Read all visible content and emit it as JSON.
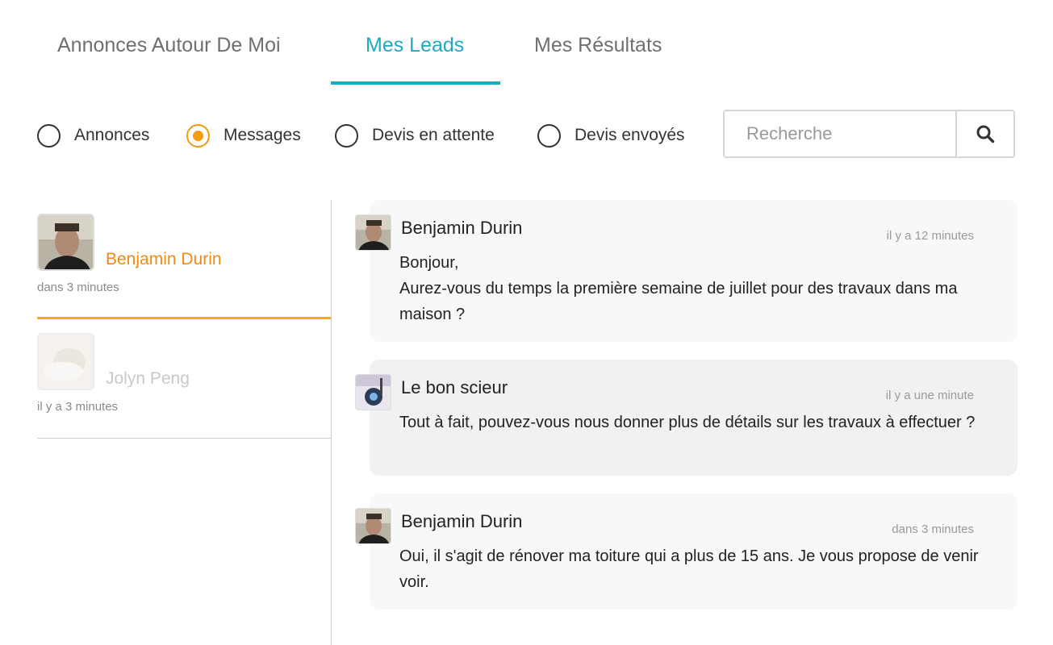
{
  "tabs": [
    {
      "label": "Annonces Autour De Moi",
      "active": false
    },
    {
      "label": "Mes Leads",
      "active": true
    },
    {
      "label": "Mes Résultats",
      "active": false
    }
  ],
  "filters": [
    {
      "label": "Annonces",
      "checked": false
    },
    {
      "label": "Messages",
      "checked": true
    },
    {
      "label": "Devis en attente",
      "checked": false
    },
    {
      "label": "Devis envoyés",
      "checked": false
    }
  ],
  "search": {
    "placeholder": "Recherche",
    "value": "",
    "icon": "search-icon"
  },
  "leads": [
    {
      "name": "Benjamin Durin",
      "time": "dans 3 minutes",
      "active": true
    },
    {
      "name": "Jolyn Peng",
      "time": "il y a 3 minutes",
      "active": false
    }
  ],
  "messages": [
    {
      "author": "Benjamin Durin",
      "time": "il y a 12 minutes",
      "lines": [
        "Bonjour,",
        "Aurez-vous du temps la première semaine de juillet pour des travaux dans ma maison ?"
      ]
    },
    {
      "author": "Le bon scieur",
      "time": "il y a une minute",
      "lines": [
        "Tout à fait, pouvez-vous nous donner plus de détails sur les travaux à effectuer ?"
      ]
    },
    {
      "author": "Benjamin Durin",
      "time": "dans 3 minutes",
      "lines": [
        "Oui, il s'agit de rénover ma toiture qui a plus de 15 ans. Je vous propose de venir voir."
      ]
    }
  ],
  "colors": {
    "accent_tab": "#1fa9c1",
    "accent_selection": "#f5a623",
    "lead_active_name": "#f08a10"
  }
}
